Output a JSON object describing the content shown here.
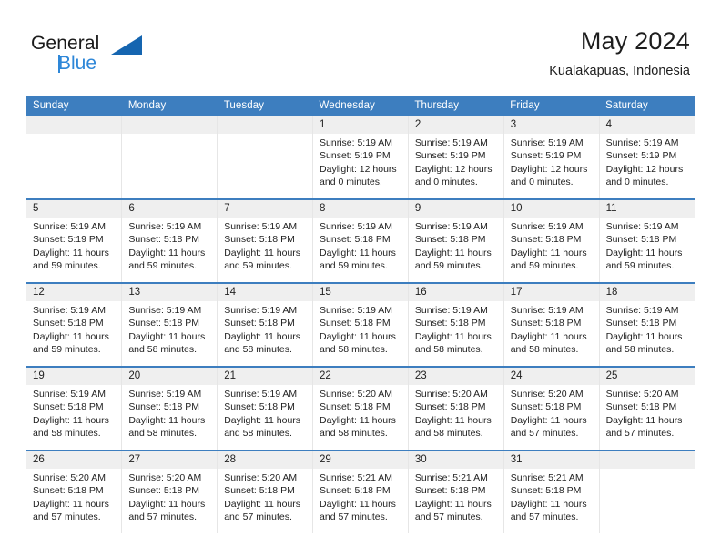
{
  "brand": {
    "name_part1": "General",
    "name_part2": "Blue",
    "logo_icon": "blue-triangle-logo",
    "accent_color": "#2e87d8",
    "dark_color": "#1565b0"
  },
  "header": {
    "title": "May 2024",
    "subtitle": "Kualakapuas, Indonesia"
  },
  "theme": {
    "header_row_bg": "#3d7ebf",
    "daynum_band_bg": "#efefef",
    "row_divider": "#3d7ebf",
    "cell_divider": "#e6e6e6"
  },
  "weekday_headers": [
    "Sunday",
    "Monday",
    "Tuesday",
    "Wednesday",
    "Thursday",
    "Friday",
    "Saturday"
  ],
  "labels": {
    "sunrise_prefix": "Sunrise:",
    "sunset_prefix": "Sunset:",
    "daylight_prefix": "Daylight:"
  },
  "weeks": [
    [
      {
        "day": "",
        "empty": true,
        "sunrise": "",
        "sunset": "",
        "daylight": ""
      },
      {
        "day": "",
        "empty": true,
        "sunrise": "",
        "sunset": "",
        "daylight": ""
      },
      {
        "day": "",
        "empty": true,
        "sunrise": "",
        "sunset": "",
        "daylight": ""
      },
      {
        "day": "1",
        "empty": false,
        "sunrise": "Sunrise: 5:19 AM",
        "sunset": "Sunset: 5:19 PM",
        "daylight": "Daylight: 12 hours and 0 minutes."
      },
      {
        "day": "2",
        "empty": false,
        "sunrise": "Sunrise: 5:19 AM",
        "sunset": "Sunset: 5:19 PM",
        "daylight": "Daylight: 12 hours and 0 minutes."
      },
      {
        "day": "3",
        "empty": false,
        "sunrise": "Sunrise: 5:19 AM",
        "sunset": "Sunset: 5:19 PM",
        "daylight": "Daylight: 12 hours and 0 minutes."
      },
      {
        "day": "4",
        "empty": false,
        "sunrise": "Sunrise: 5:19 AM",
        "sunset": "Sunset: 5:19 PM",
        "daylight": "Daylight: 12 hours and 0 minutes."
      }
    ],
    [
      {
        "day": "5",
        "empty": false,
        "sunrise": "Sunrise: 5:19 AM",
        "sunset": "Sunset: 5:19 PM",
        "daylight": "Daylight: 11 hours and 59 minutes."
      },
      {
        "day": "6",
        "empty": false,
        "sunrise": "Sunrise: 5:19 AM",
        "sunset": "Sunset: 5:18 PM",
        "daylight": "Daylight: 11 hours and 59 minutes."
      },
      {
        "day": "7",
        "empty": false,
        "sunrise": "Sunrise: 5:19 AM",
        "sunset": "Sunset: 5:18 PM",
        "daylight": "Daylight: 11 hours and 59 minutes."
      },
      {
        "day": "8",
        "empty": false,
        "sunrise": "Sunrise: 5:19 AM",
        "sunset": "Sunset: 5:18 PM",
        "daylight": "Daylight: 11 hours and 59 minutes."
      },
      {
        "day": "9",
        "empty": false,
        "sunrise": "Sunrise: 5:19 AM",
        "sunset": "Sunset: 5:18 PM",
        "daylight": "Daylight: 11 hours and 59 minutes."
      },
      {
        "day": "10",
        "empty": false,
        "sunrise": "Sunrise: 5:19 AM",
        "sunset": "Sunset: 5:18 PM",
        "daylight": "Daylight: 11 hours and 59 minutes."
      },
      {
        "day": "11",
        "empty": false,
        "sunrise": "Sunrise: 5:19 AM",
        "sunset": "Sunset: 5:18 PM",
        "daylight": "Daylight: 11 hours and 59 minutes."
      }
    ],
    [
      {
        "day": "12",
        "empty": false,
        "sunrise": "Sunrise: 5:19 AM",
        "sunset": "Sunset: 5:18 PM",
        "daylight": "Daylight: 11 hours and 59 minutes."
      },
      {
        "day": "13",
        "empty": false,
        "sunrise": "Sunrise: 5:19 AM",
        "sunset": "Sunset: 5:18 PM",
        "daylight": "Daylight: 11 hours and 58 minutes."
      },
      {
        "day": "14",
        "empty": false,
        "sunrise": "Sunrise: 5:19 AM",
        "sunset": "Sunset: 5:18 PM",
        "daylight": "Daylight: 11 hours and 58 minutes."
      },
      {
        "day": "15",
        "empty": false,
        "sunrise": "Sunrise: 5:19 AM",
        "sunset": "Sunset: 5:18 PM",
        "daylight": "Daylight: 11 hours and 58 minutes."
      },
      {
        "day": "16",
        "empty": false,
        "sunrise": "Sunrise: 5:19 AM",
        "sunset": "Sunset: 5:18 PM",
        "daylight": "Daylight: 11 hours and 58 minutes."
      },
      {
        "day": "17",
        "empty": false,
        "sunrise": "Sunrise: 5:19 AM",
        "sunset": "Sunset: 5:18 PM",
        "daylight": "Daylight: 11 hours and 58 minutes."
      },
      {
        "day": "18",
        "empty": false,
        "sunrise": "Sunrise: 5:19 AM",
        "sunset": "Sunset: 5:18 PM",
        "daylight": "Daylight: 11 hours and 58 minutes."
      }
    ],
    [
      {
        "day": "19",
        "empty": false,
        "sunrise": "Sunrise: 5:19 AM",
        "sunset": "Sunset: 5:18 PM",
        "daylight": "Daylight: 11 hours and 58 minutes."
      },
      {
        "day": "20",
        "empty": false,
        "sunrise": "Sunrise: 5:19 AM",
        "sunset": "Sunset: 5:18 PM",
        "daylight": "Daylight: 11 hours and 58 minutes."
      },
      {
        "day": "21",
        "empty": false,
        "sunrise": "Sunrise: 5:19 AM",
        "sunset": "Sunset: 5:18 PM",
        "daylight": "Daylight: 11 hours and 58 minutes."
      },
      {
        "day": "22",
        "empty": false,
        "sunrise": "Sunrise: 5:20 AM",
        "sunset": "Sunset: 5:18 PM",
        "daylight": "Daylight: 11 hours and 58 minutes."
      },
      {
        "day": "23",
        "empty": false,
        "sunrise": "Sunrise: 5:20 AM",
        "sunset": "Sunset: 5:18 PM",
        "daylight": "Daylight: 11 hours and 58 minutes."
      },
      {
        "day": "24",
        "empty": false,
        "sunrise": "Sunrise: 5:20 AM",
        "sunset": "Sunset: 5:18 PM",
        "daylight": "Daylight: 11 hours and 57 minutes."
      },
      {
        "day": "25",
        "empty": false,
        "sunrise": "Sunrise: 5:20 AM",
        "sunset": "Sunset: 5:18 PM",
        "daylight": "Daylight: 11 hours and 57 minutes."
      }
    ],
    [
      {
        "day": "26",
        "empty": false,
        "sunrise": "Sunrise: 5:20 AM",
        "sunset": "Sunset: 5:18 PM",
        "daylight": "Daylight: 11 hours and 57 minutes."
      },
      {
        "day": "27",
        "empty": false,
        "sunrise": "Sunrise: 5:20 AM",
        "sunset": "Sunset: 5:18 PM",
        "daylight": "Daylight: 11 hours and 57 minutes."
      },
      {
        "day": "28",
        "empty": false,
        "sunrise": "Sunrise: 5:20 AM",
        "sunset": "Sunset: 5:18 PM",
        "daylight": "Daylight: 11 hours and 57 minutes."
      },
      {
        "day": "29",
        "empty": false,
        "sunrise": "Sunrise: 5:21 AM",
        "sunset": "Sunset: 5:18 PM",
        "daylight": "Daylight: 11 hours and 57 minutes."
      },
      {
        "day": "30",
        "empty": false,
        "sunrise": "Sunrise: 5:21 AM",
        "sunset": "Sunset: 5:18 PM",
        "daylight": "Daylight: 11 hours and 57 minutes."
      },
      {
        "day": "31",
        "empty": false,
        "sunrise": "Sunrise: 5:21 AM",
        "sunset": "Sunset: 5:18 PM",
        "daylight": "Daylight: 11 hours and 57 minutes."
      },
      {
        "day": "",
        "empty": true,
        "sunrise": "",
        "sunset": "",
        "daylight": ""
      }
    ]
  ]
}
